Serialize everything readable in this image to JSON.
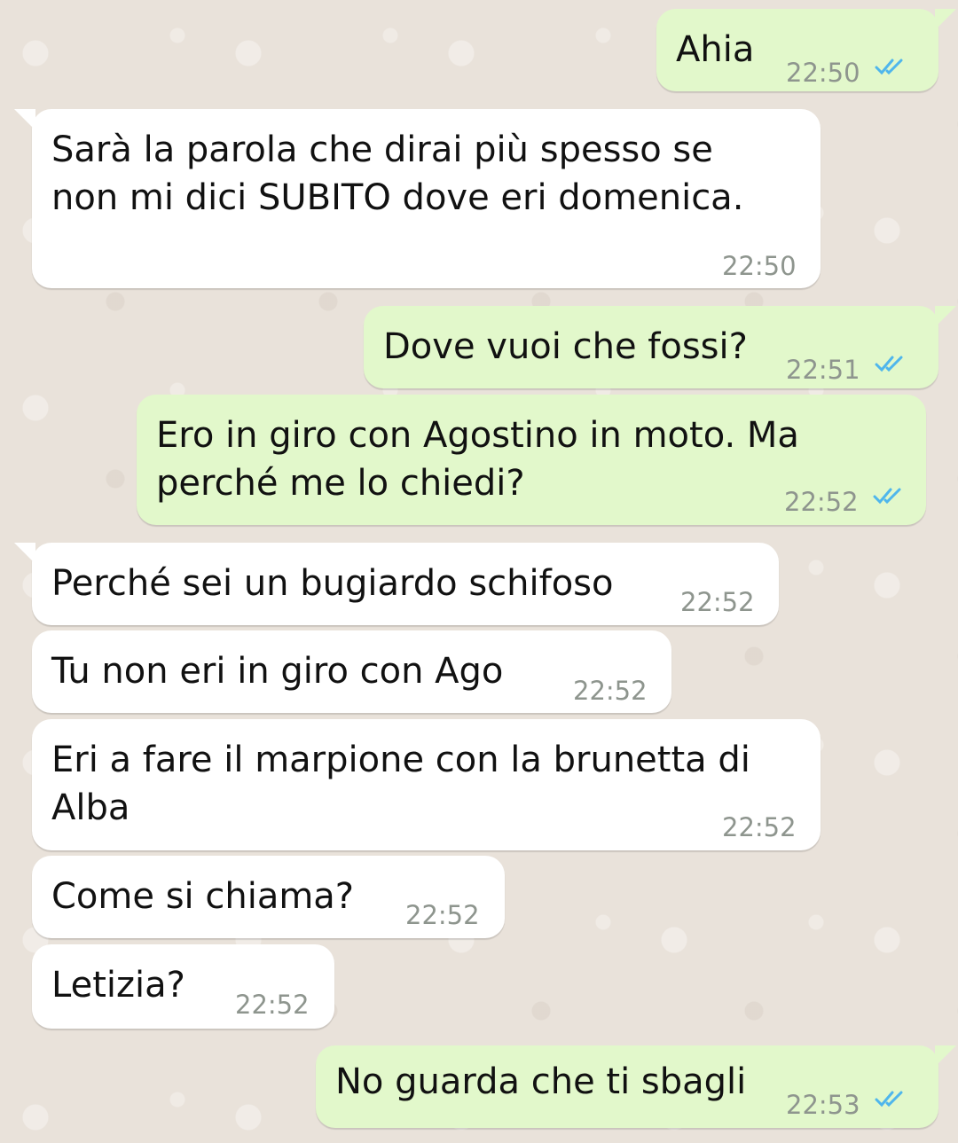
{
  "chat": {
    "messages": [
      {
        "direction": "out",
        "lines": [
          "Ahia"
        ],
        "time": "22:50",
        "read": true
      },
      {
        "direction": "in",
        "lines": [
          "Sarà la parola che dirai più spesso se",
          "non mi dici SUBITO dove eri domenica."
        ],
        "time": "22:50"
      },
      {
        "direction": "out",
        "lines": [
          "Dove vuoi che fossi?"
        ],
        "time": "22:51",
        "read": true
      },
      {
        "direction": "out",
        "lines": [
          "Ero in giro con Agostino in moto. Ma",
          "perché me lo chiedi?"
        ],
        "time": "22:52",
        "read": true
      },
      {
        "direction": "in",
        "lines": [
          "Perché sei un bugiardo schifoso"
        ],
        "time": "22:52"
      },
      {
        "direction": "in",
        "lines": [
          "Tu non eri in giro con Ago"
        ],
        "time": "22:52"
      },
      {
        "direction": "in",
        "lines": [
          "Eri a fare il marpione con la brunetta di",
          "Alba"
        ],
        "time": "22:52"
      },
      {
        "direction": "in",
        "lines": [
          "Come si chiama?"
        ],
        "time": "22:52"
      },
      {
        "direction": "in",
        "lines": [
          "Letizia?"
        ],
        "time": "22:52"
      },
      {
        "direction": "out",
        "lines": [
          "No guarda che ti sbagli"
        ],
        "time": "22:53",
        "read": true
      }
    ]
  },
  "icons": {
    "read_receipt": "double-check-icon"
  },
  "colors": {
    "outgoing_bubble": "#E2F8CB",
    "incoming_bubble": "#FFFFFF",
    "chat_background": "#E9E2DA",
    "timestamp": "#8E958E",
    "read_ticks": "#4FB6EC"
  }
}
